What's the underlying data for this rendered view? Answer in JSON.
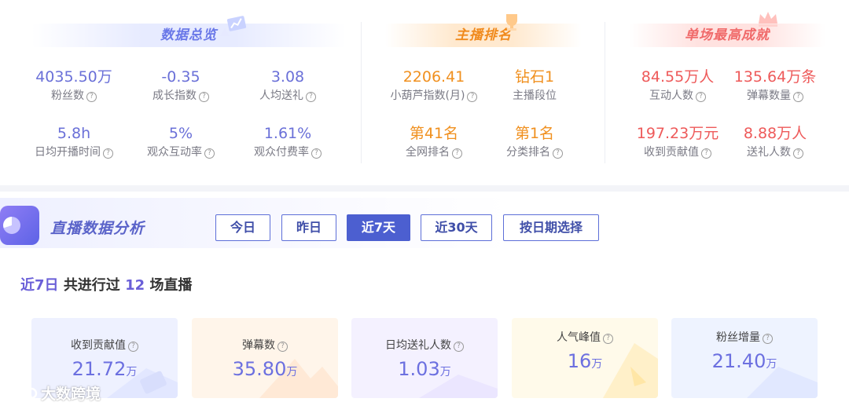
{
  "overview": {
    "title": "数据总览",
    "stats": [
      {
        "value": "4035.50万",
        "label": "粉丝数"
      },
      {
        "value": "-0.35",
        "label": "成长指数"
      },
      {
        "value": "3.08",
        "label": "人均送礼"
      },
      {
        "value": "5.8h",
        "label": "日均开播时间"
      },
      {
        "value": "5%",
        "label": "观众互动率"
      },
      {
        "value": "1.61%",
        "label": "观众付费率"
      }
    ]
  },
  "ranking": {
    "title": "主播排名",
    "stats": [
      {
        "value": "2206.41",
        "label": "小葫芦指数(月)"
      },
      {
        "value": "钻石1",
        "label": "主播段位"
      },
      {
        "value": "第41名",
        "label": "全网排名"
      },
      {
        "value": "第1名",
        "label": "分类排名"
      }
    ]
  },
  "record": {
    "title": "单场最高成就",
    "stats": [
      {
        "value": "84.55万人",
        "label": "互动人数"
      },
      {
        "value": "135.64万条",
        "label": "弹幕数量"
      },
      {
        "value": "197.23万元",
        "label": "收到贡献值"
      },
      {
        "value": "8.88万人",
        "label": "送礼人数"
      }
    ]
  },
  "analysis": {
    "title": "直播数据分析",
    "tabs": [
      "今日",
      "昨日",
      "近7天",
      "近30天",
      "按日期选择"
    ],
    "active_tab": "近7天",
    "summary": {
      "period": "近7日",
      "text1": "共进行过",
      "count": "12",
      "text2": "场直播"
    },
    "cards": [
      {
        "label": "收到贡献值",
        "value": "21.72",
        "unit": "万"
      },
      {
        "label": "弹幕数",
        "value": "35.80",
        "unit": "万"
      },
      {
        "label": "日均送礼人数",
        "value": "1.03",
        "unit": "万"
      },
      {
        "label": "人气峰值",
        "value": "16",
        "unit": "万"
      },
      {
        "label": "粉丝增量",
        "value": "21.40",
        "unit": "万"
      }
    ]
  },
  "watermark": "大数跨境",
  "help_glyph": "?",
  "colors": {
    "overview": "#6a70d8",
    "ranking": "#f0901f",
    "record": "#ee5a5a",
    "accent": "#4c5fd0"
  }
}
